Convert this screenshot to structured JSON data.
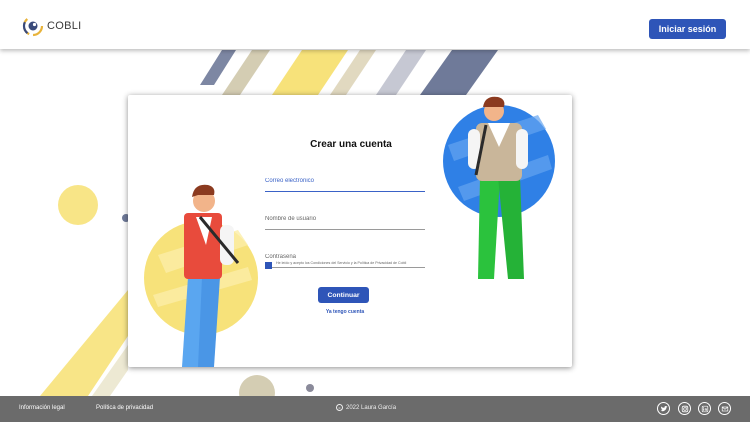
{
  "header": {
    "brand": "COBLI",
    "login_label": "Iniciar sesión"
  },
  "form": {
    "title": "Crear una cuenta",
    "email_placeholder": "Correo electrónico",
    "username_placeholder": "Nombre de usuario",
    "password_placeholder": "Contraseña",
    "terms_text": "He leído y acepto los Condiciones del Servicio y la Política de Privacidad de Cobli",
    "terms_checked": true,
    "continue_label": "Continuar",
    "have_account_label": "Ya tengo cuenta"
  },
  "footer": {
    "legal_label": "Información legal",
    "privacy_label": "Política de privacidad",
    "copyright": "2022  Laura García",
    "social_icons": [
      "twitter-icon",
      "instagram-icon",
      "linkedin-icon",
      "mail-icon"
    ]
  },
  "colors": {
    "primary": "#2e55b8",
    "footer_bg": "#6b6b6b",
    "deco_yellow": "#f7e27a",
    "deco_blue": "#2f80e6",
    "shirt_red": "#e84b3c",
    "pants_green": "#2bc23d"
  }
}
